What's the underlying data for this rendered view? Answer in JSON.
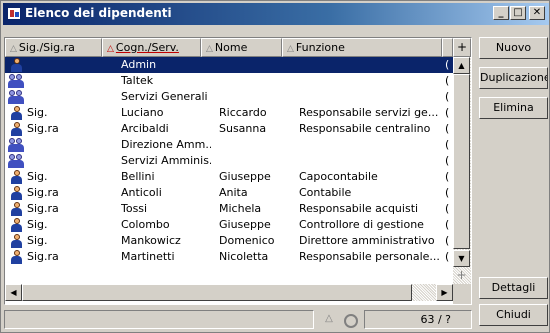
{
  "window": {
    "title": "Elenco dei dipendenti",
    "minimize_glyph": "_",
    "maximize_glyph": "□",
    "close_glyph": "✕"
  },
  "columns": [
    {
      "label": "Sig./Sig.ra",
      "sorted": false
    },
    {
      "label": "Cogn./Serv.",
      "sorted": true
    },
    {
      "label": "Nome",
      "sorted": false
    },
    {
      "label": "Funzione",
      "sorted": false
    },
    {
      "label": "",
      "sorted": false
    }
  ],
  "header_plus": "+",
  "rows": [
    {
      "icon": "person-icon",
      "title": "",
      "surname": "Admin",
      "name": "",
      "function": "",
      "extra": "(",
      "selected": true
    },
    {
      "icon": "group-icon",
      "title": "",
      "surname": "Taltek",
      "name": "",
      "function": "",
      "extra": "(",
      "selected": false
    },
    {
      "icon": "group-icon",
      "title": "",
      "surname": "Servizi Generali",
      "name": "",
      "function": "",
      "extra": "(",
      "selected": false
    },
    {
      "icon": "person-icon",
      "title": "Sig.",
      "surname": "Luciano",
      "name": "Riccardo",
      "function": "Responsabile servizi ge...",
      "extra": "(",
      "selected": false
    },
    {
      "icon": "person-icon",
      "title": "Sig.ra",
      "surname": "Arcibaldi",
      "name": "Susanna",
      "function": "Responsabile centralino",
      "extra": "(",
      "selected": false
    },
    {
      "icon": "group-icon",
      "title": "",
      "surname": "Direzione Amm....",
      "name": "",
      "function": "",
      "extra": "(",
      "selected": false
    },
    {
      "icon": "group-icon",
      "title": "",
      "surname": "Servizi Amminis...",
      "name": "",
      "function": "",
      "extra": "(",
      "selected": false
    },
    {
      "icon": "person-icon",
      "title": "Sig.",
      "surname": "Bellini",
      "name": "Giuseppe",
      "function": "Capocontabile",
      "extra": "(",
      "selected": false
    },
    {
      "icon": "person-icon",
      "title": "Sig.ra",
      "surname": "Anticoli",
      "name": "Anita",
      "function": "Contabile",
      "extra": "(",
      "selected": false
    },
    {
      "icon": "person-icon",
      "title": "Sig.ra",
      "surname": "Tossi",
      "name": "Michela",
      "function": "Responsabile acquisti",
      "extra": "(",
      "selected": false
    },
    {
      "icon": "person-icon",
      "title": "Sig.",
      "surname": "Colombo",
      "name": "Giuseppe",
      "function": "Controllore di gestione",
      "extra": "(",
      "selected": false
    },
    {
      "icon": "person-icon",
      "title": "Sig.",
      "surname": "Mankowicz",
      "name": "Domenico",
      "function": "Direttore amministrativo ...",
      "extra": "(",
      "selected": false
    },
    {
      "icon": "person-icon",
      "title": "Sig.ra",
      "surname": "Martinetti",
      "name": "Nicoletta",
      "function": "Responsabile personale...",
      "extra": "(",
      "selected": false
    }
  ],
  "buttons": {
    "new": "Nuovo",
    "duplicate": "Duplicazione",
    "delete": "Elimina",
    "details": "Dettagli",
    "close": "Chiudi"
  },
  "status": {
    "count": "63 / ?",
    "sort_glyph": "△"
  },
  "colors": {
    "selection": "#0a246a",
    "title_gradient_start": "#0a246a",
    "face": "#d4d0c8",
    "sort_accent": "#c00000"
  }
}
